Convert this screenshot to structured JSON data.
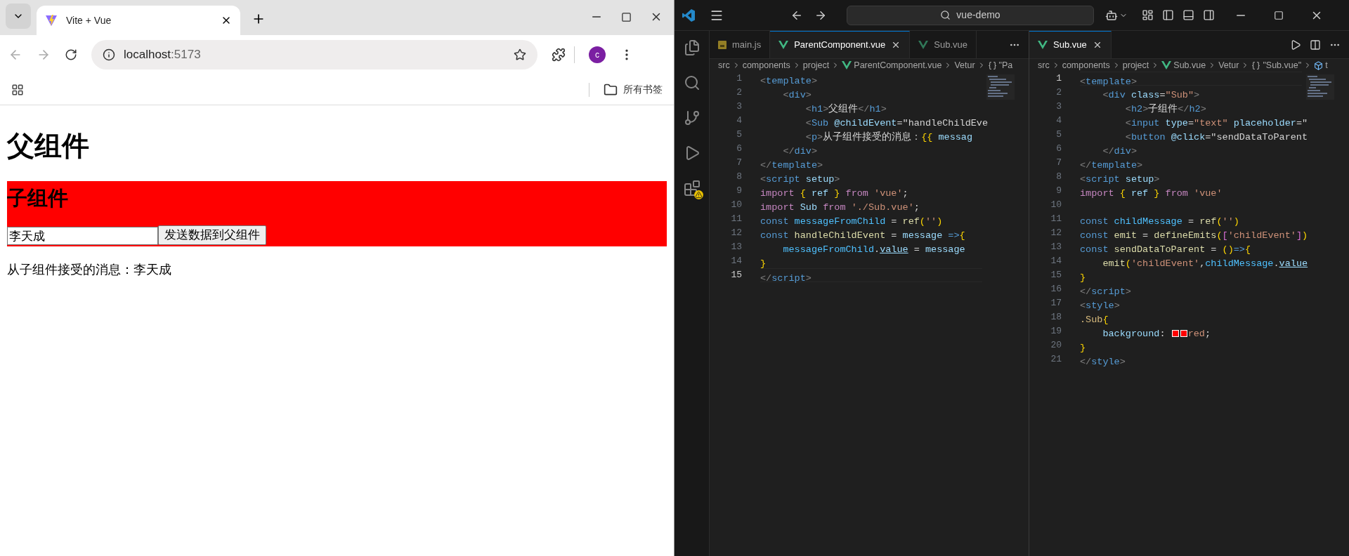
{
  "browser": {
    "tabs": [
      {
        "title": "Vite + Vue",
        "selected": true
      }
    ],
    "url_host": "localhost",
    "url_port": ":5173",
    "avatar": "c",
    "bookmarks_all": "所有书签",
    "page": {
      "heading": "父组件",
      "child_heading": "子组件",
      "input_value": "李天成",
      "send_button": "发送数据到父组件",
      "message": "从子组件接受的消息：李天成"
    }
  },
  "vscode": {
    "search": "vue-demo",
    "groups": [
      {
        "tabs": [
          {
            "label": "main.js",
            "kind": "js",
            "selected": false
          },
          {
            "label": "ParentComponent.vue",
            "kind": "vue",
            "selected": true
          },
          {
            "label": "Sub.vue",
            "kind": "vue",
            "selected": false
          }
        ],
        "breadcrumbs": [
          {
            "label": "src"
          },
          {
            "label": "components"
          },
          {
            "label": "project"
          },
          {
            "label": "ParentComponent.vue",
            "kind": "vue"
          },
          {
            "label": "Vetur"
          },
          {
            "label": "\"Pa",
            "kind": "braces"
          }
        ],
        "lines": [
          {
            "number": "1",
            "current": false,
            "tokens": [
              {
                "kind": "punct",
                "text": "<"
              },
              {
                "kind": "tag",
                "text": "template"
              },
              {
                "kind": "punct",
                "text": ">"
              }
            ]
          },
          {
            "number": "2",
            "current": false,
            "tokens": [
              {
                "kind": "punct",
                "text": "    <"
              },
              {
                "kind": "tag",
                "text": "div"
              },
              {
                "kind": "punct",
                "text": ">"
              }
            ]
          },
          {
            "number": "3",
            "current": false,
            "tokens": [
              {
                "kind": "punct",
                "text": "        <"
              },
              {
                "kind": "tag",
                "text": "h1"
              },
              {
                "kind": "punct",
                "text": ">"
              },
              {
                "kind": "plain",
                "text": "父组件"
              },
              {
                "kind": "punct",
                "text": "</"
              },
              {
                "kind": "tag",
                "text": "h1"
              },
              {
                "kind": "punct",
                "text": ">"
              }
            ]
          },
          {
            "number": "4",
            "current": false,
            "tokens": [
              {
                "kind": "punct",
                "text": "        <"
              },
              {
                "kind": "tag",
                "text": "Sub "
              },
              {
                "kind": "attr",
                "text": "@childEvent"
              },
              {
                "kind": "plain",
                "text": "=\"handleChildEve"
              }
            ]
          },
          {
            "number": "5",
            "current": false,
            "tokens": [
              {
                "kind": "punct",
                "text": "        <"
              },
              {
                "kind": "tag",
                "text": "p"
              },
              {
                "kind": "punct",
                "text": ">"
              },
              {
                "kind": "plain",
                "text": "从子组件接受的消息："
              },
              {
                "kind": "bracket",
                "text": "{{ "
              },
              {
                "kind": "variable",
                "text": "messag"
              }
            ]
          },
          {
            "number": "6",
            "current": false,
            "tokens": [
              {
                "kind": "punct",
                "text": "    </"
              },
              {
                "kind": "tag",
                "text": "div"
              },
              {
                "kind": "punct",
                "text": ">"
              }
            ]
          },
          {
            "number": "7",
            "current": false,
            "tokens": [
              {
                "kind": "punct",
                "text": "</"
              },
              {
                "kind": "tag",
                "text": "template"
              },
              {
                "kind": "punct",
                "text": ">"
              }
            ]
          },
          {
            "number": "8",
            "current": false,
            "tokens": [
              {
                "kind": "punct",
                "text": "<"
              },
              {
                "kind": "tag",
                "text": "script "
              },
              {
                "kind": "attr",
                "text": "setup"
              },
              {
                "kind": "punct",
                "text": ">"
              }
            ]
          },
          {
            "number": "9",
            "current": false,
            "tokens": [
              {
                "kind": "keyword",
                "text": "import "
              },
              {
                "kind": "bracket",
                "text": "{ "
              },
              {
                "kind": "variable",
                "text": "ref "
              },
              {
                "kind": "bracket",
                "text": "} "
              },
              {
                "kind": "keyword",
                "text": "from "
              },
              {
                "kind": "string",
                "text": "'vue'"
              },
              {
                "kind": "plain",
                "text": ";"
              }
            ]
          },
          {
            "number": "10",
            "current": false,
            "tokens": [
              {
                "kind": "keyword",
                "text": "import "
              },
              {
                "kind": "variable",
                "text": "Sub "
              },
              {
                "kind": "keyword",
                "text": "from "
              },
              {
                "kind": "string",
                "text": "'./Sub.vue'"
              },
              {
                "kind": "plain",
                "text": ";"
              }
            ]
          },
          {
            "number": "11",
            "current": false,
            "tokens": [
              {
                "kind": "storage",
                "text": "const "
              },
              {
                "kind": "constant",
                "text": "messageFromChild"
              },
              {
                "kind": "plain",
                "text": " = "
              },
              {
                "kind": "function",
                "text": "ref"
              },
              {
                "kind": "bracket",
                "text": "("
              },
              {
                "kind": "string",
                "text": "''"
              },
              {
                "kind": "bracket",
                "text": ")"
              }
            ]
          },
          {
            "number": "12",
            "current": false,
            "tokens": [
              {
                "kind": "storage",
                "text": "const "
              },
              {
                "kind": "function",
                "text": "handleChildEvent"
              },
              {
                "kind": "plain",
                "text": " = "
              },
              {
                "kind": "variable",
                "text": "message "
              },
              {
                "kind": "storage",
                "text": "=>"
              },
              {
                "kind": "bracket",
                "text": "{"
              }
            ]
          },
          {
            "number": "13",
            "current": false,
            "tokens": [
              {
                "kind": "constant",
                "text": "    messageFromChild"
              },
              {
                "kind": "plain",
                "text": "."
              },
              {
                "kind": "member",
                "text": "value"
              },
              {
                "kind": "plain",
                "text": " = "
              },
              {
                "kind": "variable",
                "text": "message"
              }
            ]
          },
          {
            "number": "14",
            "current": false,
            "tokens": [
              {
                "kind": "bracket",
                "text": "}"
              }
            ]
          },
          {
            "number": "15",
            "current": true,
            "tokens": [
              {
                "kind": "punct",
                "text": "</"
              },
              {
                "kind": "tag",
                "text": "script"
              },
              {
                "kind": "punct",
                "text": ">"
              }
            ]
          }
        ]
      },
      {
        "tabs": [
          {
            "label": "Sub.vue",
            "kind": "vue",
            "selected": true
          }
        ],
        "breadcrumbs": [
          {
            "label": "src"
          },
          {
            "label": "components"
          },
          {
            "label": "project"
          },
          {
            "label": "Sub.vue",
            "kind": "vue"
          },
          {
            "label": "Vetur"
          },
          {
            "label": "\"Sub.vue\"",
            "kind": "braces"
          },
          {
            "label": "t",
            "kind": "cube"
          }
        ],
        "lines": [
          {
            "number": "1",
            "current": true,
            "tokens": [
              {
                "kind": "punct",
                "text": "<"
              },
              {
                "kind": "tag",
                "text": "template"
              },
              {
                "kind": "punct",
                "text": ">"
              }
            ]
          },
          {
            "number": "2",
            "current": false,
            "tokens": [
              {
                "kind": "punct",
                "text": "    <"
              },
              {
                "kind": "tag",
                "text": "div "
              },
              {
                "kind": "attr",
                "text": "class"
              },
              {
                "kind": "plain",
                "text": "="
              },
              {
                "kind": "string",
                "text": "\"Sub\""
              },
              {
                "kind": "punct",
                "text": ">"
              }
            ]
          },
          {
            "number": "3",
            "current": false,
            "tokens": [
              {
                "kind": "punct",
                "text": "        <"
              },
              {
                "kind": "tag",
                "text": "h2"
              },
              {
                "kind": "punct",
                "text": ">"
              },
              {
                "kind": "plain",
                "text": "子组件"
              },
              {
                "kind": "punct",
                "text": "</"
              },
              {
                "kind": "tag",
                "text": "h2"
              },
              {
                "kind": "punct",
                "text": ">"
              }
            ]
          },
          {
            "number": "4",
            "current": false,
            "tokens": [
              {
                "kind": "punct",
                "text": "        <"
              },
              {
                "kind": "tag",
                "text": "input "
              },
              {
                "kind": "attr",
                "text": "type"
              },
              {
                "kind": "plain",
                "text": "="
              },
              {
                "kind": "string",
                "text": "\"text\" "
              },
              {
                "kind": "attr",
                "text": "placeholder"
              },
              {
                "kind": "plain",
                "text": "=\""
              }
            ]
          },
          {
            "number": "5",
            "current": false,
            "tokens": [
              {
                "kind": "punct",
                "text": "        <"
              },
              {
                "kind": "tag",
                "text": "button "
              },
              {
                "kind": "attr",
                "text": "@click"
              },
              {
                "kind": "plain",
                "text": "=\"sendDataToParent"
              }
            ]
          },
          {
            "number": "6",
            "current": false,
            "tokens": [
              {
                "kind": "punct",
                "text": "    </"
              },
              {
                "kind": "tag",
                "text": "div"
              },
              {
                "kind": "punct",
                "text": ">"
              }
            ]
          },
          {
            "number": "7",
            "current": false,
            "tokens": [
              {
                "kind": "punct",
                "text": "</"
              },
              {
                "kind": "tag",
                "text": "template"
              },
              {
                "kind": "punct",
                "text": ">"
              }
            ]
          },
          {
            "number": "8",
            "current": false,
            "tokens": [
              {
                "kind": "punct",
                "text": "<"
              },
              {
                "kind": "tag",
                "text": "script "
              },
              {
                "kind": "attr",
                "text": "setup"
              },
              {
                "kind": "punct",
                "text": ">"
              }
            ]
          },
          {
            "number": "9",
            "current": false,
            "tokens": [
              {
                "kind": "keyword",
                "text": "import "
              },
              {
                "kind": "bracket",
                "text": "{ "
              },
              {
                "kind": "variable",
                "text": "ref "
              },
              {
                "kind": "bracket",
                "text": "} "
              },
              {
                "kind": "keyword",
                "text": "from "
              },
              {
                "kind": "string",
                "text": "'vue'"
              }
            ]
          },
          {
            "number": "10",
            "current": false
          },
          {
            "number": "11",
            "current": false,
            "tokens": [
              {
                "kind": "storage",
                "text": "const "
              },
              {
                "kind": "constant",
                "text": "childMessage"
              },
              {
                "kind": "plain",
                "text": " = "
              },
              {
                "kind": "function",
                "text": "ref"
              },
              {
                "kind": "bracket",
                "text": "("
              },
              {
                "kind": "string",
                "text": "''"
              },
              {
                "kind": "bracket",
                "text": ")"
              }
            ]
          },
          {
            "number": "12",
            "current": false,
            "tokens": [
              {
                "kind": "storage",
                "text": "const "
              },
              {
                "kind": "function",
                "text": "emit"
              },
              {
                "kind": "plain",
                "text": " = "
              },
              {
                "kind": "function",
                "text": "defineEmits"
              },
              {
                "kind": "bracket",
                "text": "("
              },
              {
                "kind": "bracket2",
                "text": "["
              },
              {
                "kind": "string",
                "text": "'childEvent'"
              },
              {
                "kind": "bracket2",
                "text": "]"
              },
              {
                "kind": "bracket",
                "text": ")"
              }
            ]
          },
          {
            "number": "13",
            "current": false,
            "tokens": [
              {
                "kind": "storage",
                "text": "const "
              },
              {
                "kind": "function",
                "text": "sendDataToParent"
              },
              {
                "kind": "plain",
                "text": " = "
              },
              {
                "kind": "bracket",
                "text": "()"
              },
              {
                "kind": "storage",
                "text": "=>"
              },
              {
                "kind": "bracket",
                "text": "{"
              }
            ]
          },
          {
            "number": "14",
            "current": false,
            "tokens": [
              {
                "kind": "function",
                "text": "    emit"
              },
              {
                "kind": "bracket",
                "text": "("
              },
              {
                "kind": "string",
                "text": "'childEvent'"
              },
              {
                "kind": "plain",
                "text": ","
              },
              {
                "kind": "constant",
                "text": "childMessage"
              },
              {
                "kind": "plain",
                "text": "."
              },
              {
                "kind": "member",
                "text": "value"
              }
            ]
          },
          {
            "number": "15",
            "current": false,
            "tokens": [
              {
                "kind": "bracket",
                "text": "}"
              }
            ]
          },
          {
            "number": "16",
            "current": false,
            "tokens": [
              {
                "kind": "punct",
                "text": "</"
              },
              {
                "kind": "tag",
                "text": "script"
              },
              {
                "kind": "punct",
                "text": ">"
              }
            ]
          },
          {
            "number": "17",
            "current": false,
            "tokens": [
              {
                "kind": "punct",
                "text": "<"
              },
              {
                "kind": "tag",
                "text": "style"
              },
              {
                "kind": "punct",
                "text": ">"
              }
            ]
          },
          {
            "number": "18",
            "current": false,
            "tokens": [
              {
                "kind": "selector",
                "text": ".Sub"
              },
              {
                "kind": "bracket",
                "text": "{"
              }
            ]
          },
          {
            "number": "19",
            "current": false,
            "tokens": [
              {
                "kind": "attr",
                "text": "    background"
              },
              {
                "kind": "plain",
                "text": ": "
              },
              {
                "kind": "swatch",
                "color": "#ff0000"
              },
              {
                "kind": "swatch",
                "color": "#ff0000"
              },
              {
                "kind": "string",
                "text": "red"
              },
              {
                "kind": "plain",
                "text": ";"
              }
            ]
          },
          {
            "number": "20",
            "current": false,
            "tokens": [
              {
                "kind": "bracket",
                "text": "}"
              }
            ]
          },
          {
            "number": "21",
            "current": false,
            "tokens": [
              {
                "kind": "punct",
                "text": "</"
              },
              {
                "kind": "tag",
                "text": "style"
              },
              {
                "kind": "punct",
                "text": ">"
              }
            ]
          }
        ]
      }
    ]
  }
}
